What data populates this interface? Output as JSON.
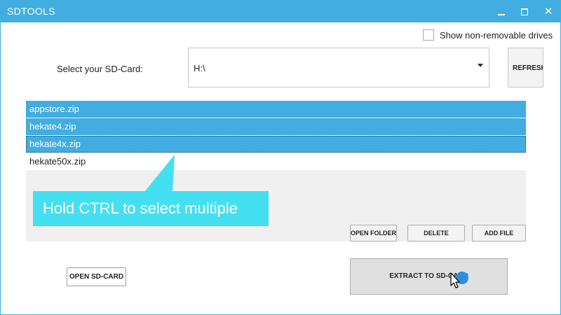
{
  "window": {
    "title": "SDTOOLS"
  },
  "options": {
    "show_nonremovable_label": "Show non-removable drives",
    "show_nonremovable_checked": false
  },
  "sd_select": {
    "label": "Select your SD-Card:",
    "value": "H:\\",
    "refresh_label": "REFRESH"
  },
  "files": [
    {
      "name": "appstore.zip",
      "selected": true
    },
    {
      "name": "hekate4.zip",
      "selected": true
    },
    {
      "name": "hekate4x.zip",
      "selected": true
    },
    {
      "name": "hekate50x.zip",
      "selected": false
    }
  ],
  "tooltip": {
    "text": "Hold CTRL to select multiple"
  },
  "file_actions": {
    "open_folder": "OPEN FOLDER",
    "delete": "DELETE",
    "add_file": "ADD FILE"
  },
  "bottom": {
    "open_sd": "OPEN SD-CARD",
    "extract": "EXTRACT TO SD-CARD"
  },
  "colors": {
    "accent": "#41ade0",
    "tooltip": "#44e0f2",
    "cursor_dot": "#2b8fe0"
  },
  "icons": {
    "minimize": "minimize-icon",
    "maximize": "maximize-icon",
    "close": "close-icon",
    "dropdown": "chevron-down-icon",
    "pointer": "mouse-pointer-icon"
  }
}
